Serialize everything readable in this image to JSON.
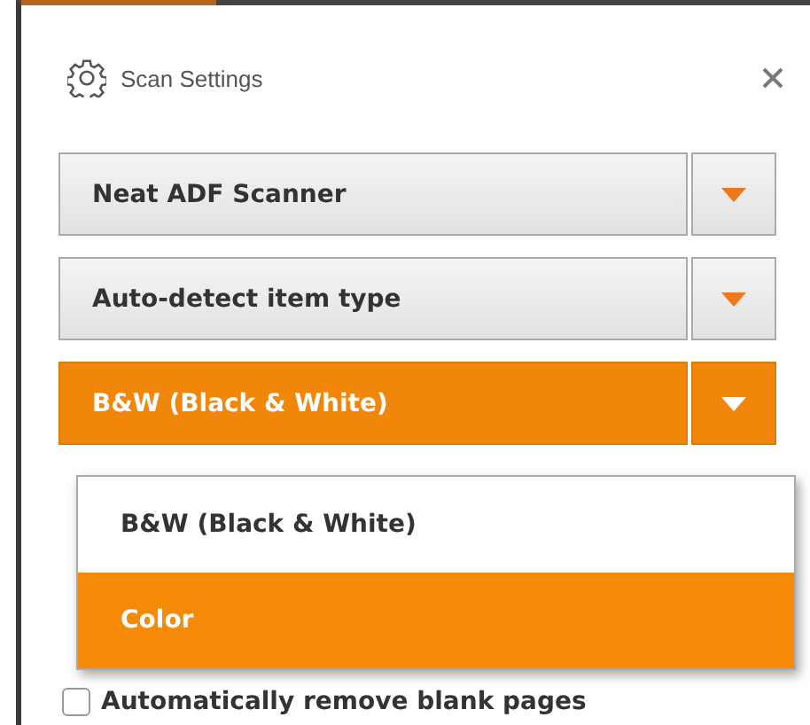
{
  "window": {
    "title": "Scan Settings"
  },
  "dropdowns": [
    {
      "value": "Neat ADF Scanner",
      "open": false
    },
    {
      "value": "Auto-detect item type",
      "open": false
    },
    {
      "value": "B&W (Black & White)",
      "open": true
    }
  ],
  "menu": {
    "options": [
      {
        "label": "B&W (Black & White)",
        "selected": false
      },
      {
        "label": "Color",
        "selected": true
      }
    ]
  },
  "checkboxes": [
    {
      "label": "Automatically remove blank pages",
      "checked": false
    }
  ]
}
